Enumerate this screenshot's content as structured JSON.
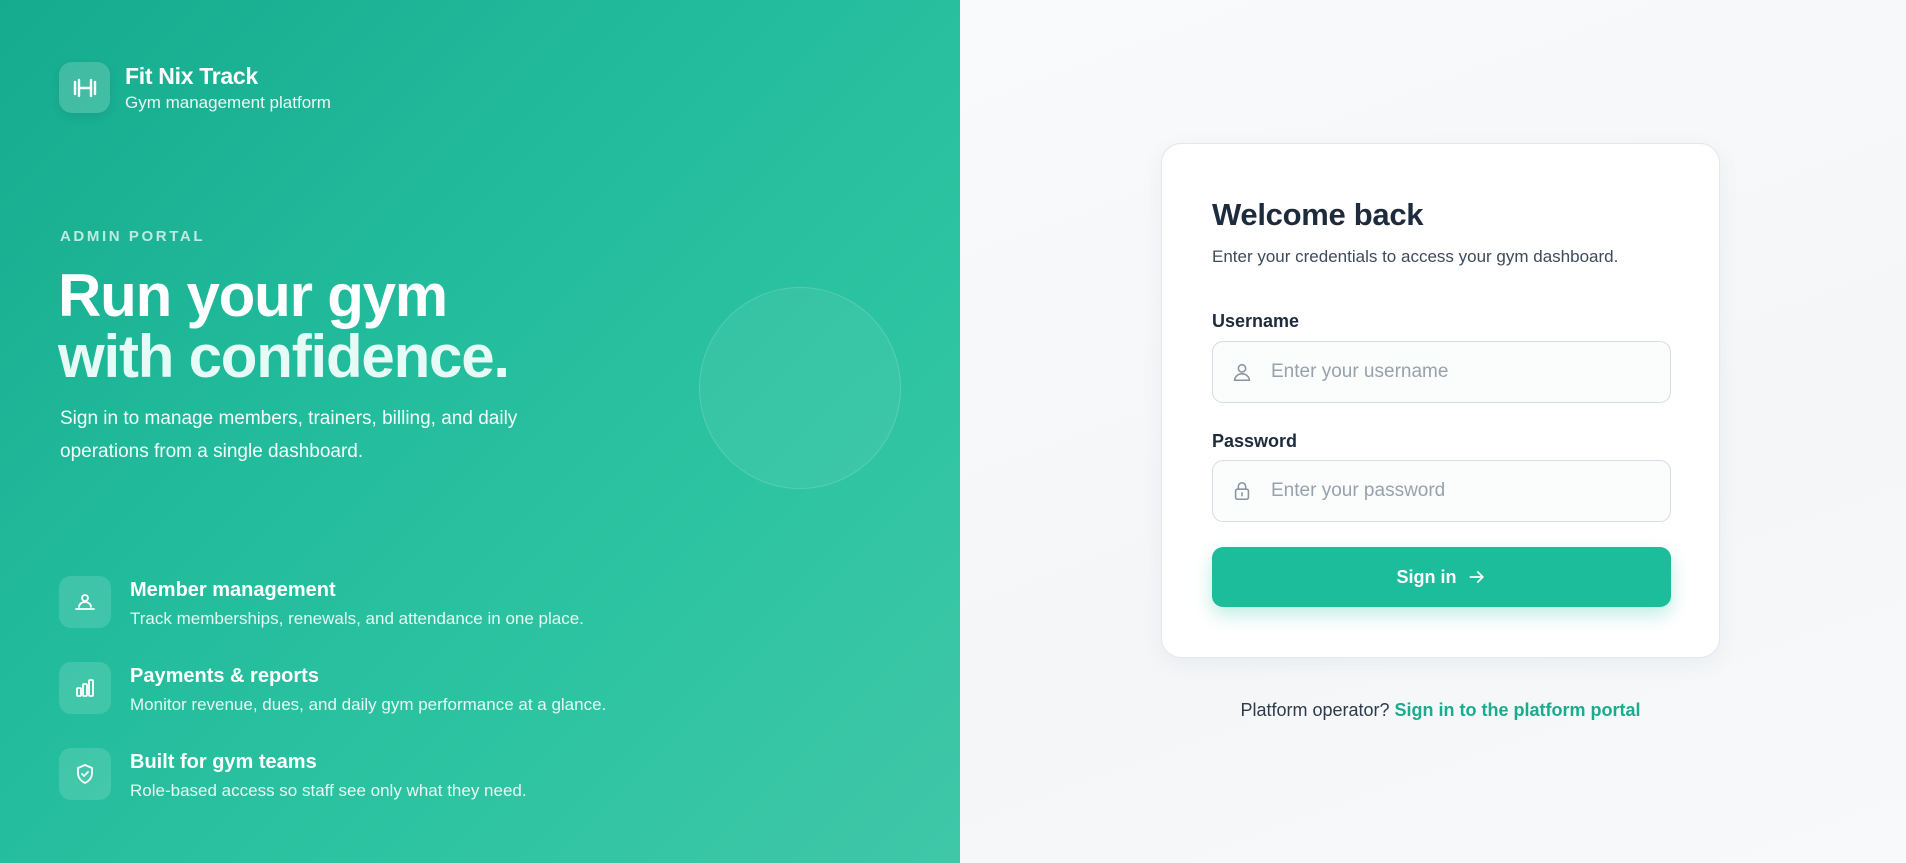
{
  "brand": {
    "name": "Fit Nix Track",
    "tagline": "Gym management platform",
    "logo_icon": "dumbbell-icon"
  },
  "hero": {
    "eyebrow": "ADMIN PORTAL",
    "headline_line1": "Run your gym",
    "headline_line2": "with confidence.",
    "lead": "Sign in to manage members, trainers, billing, and daily operations from a single dashboard."
  },
  "features": [
    {
      "icon": "members-icon",
      "title": "Member management",
      "desc": "Track memberships, renewals, and attendance in one place."
    },
    {
      "icon": "bar-chart-icon",
      "title": "Payments & reports",
      "desc": "Monitor revenue, dues, and daily gym performance at a glance."
    },
    {
      "icon": "shield-check-icon",
      "title": "Built for gym teams",
      "desc": "Role-based access so staff see only what they need."
    }
  ],
  "login": {
    "title": "Welcome back",
    "subtitle": "Enter your credentials to access your gym dashboard.",
    "username_label": "Username",
    "username_placeholder": "Enter your username",
    "password_label": "Password",
    "password_placeholder": "Enter your password",
    "submit_label": "Sign in"
  },
  "footer": {
    "prompt": "Platform operator?",
    "link": "Sign in to the platform portal"
  },
  "colors": {
    "accent": "#1bbd9b",
    "panel_start": "#16ab8e",
    "panel_end": "#40c7a8",
    "text_dark": "#1e2b3c"
  }
}
